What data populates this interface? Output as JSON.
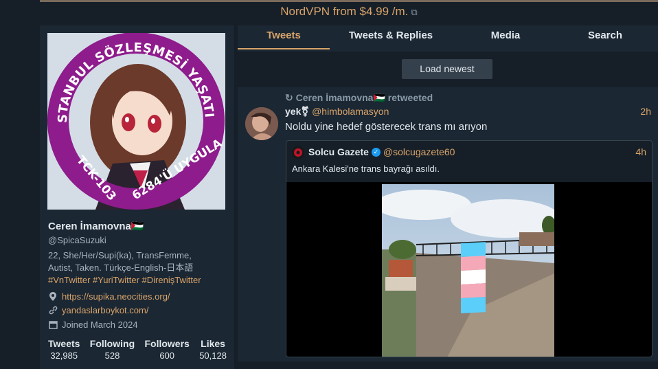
{
  "ad": {
    "text": "NordVPN from $4.99 /m.",
    "icon": "external-link-icon"
  },
  "profile": {
    "avatar_ring_top": "İSTANBUL SÖZLEŞMESİ YAŞATIR",
    "avatar_ring_left": "TCK-103",
    "avatar_ring_right": "6284'Ü UYGULA",
    "name": "Ceren İmamovna🇵🇸",
    "handle": "@SpicaSuzuki",
    "bio_line1": "22, She/Her/Supi(ka), TransFemme,",
    "bio_line2": "Autist, Taken. Türkçe-English-日本語",
    "bio_tags": "#VnTwitter #YuriTwitter #DirenişTwitter",
    "location_link": "https://supika.neocities.org/",
    "website": "yandaslarboykot.com/",
    "joined": "Joined March 2024",
    "stats": [
      {
        "label": "Tweets",
        "value": "32,985"
      },
      {
        "label": "Following",
        "value": "528"
      },
      {
        "label": "Followers",
        "value": "600"
      },
      {
        "label": "Likes",
        "value": "50,128"
      }
    ]
  },
  "tabs": [
    {
      "label": "Tweets"
    },
    {
      "label": "Tweets & Replies"
    },
    {
      "label": "Media"
    },
    {
      "label": "Search"
    }
  ],
  "load_newest": "Load newest",
  "tweet": {
    "retweet_text": "Ceren İmamovna🇵🇸 retweeted",
    "name": "yek⚧",
    "handle": "@himbolamasyon",
    "time": "2h",
    "text": "Noldu yine hedef gösterecek trans mı arıyon",
    "quote": {
      "name": "Solcu Gazete",
      "handle": "@solcugazete60",
      "time": "4h",
      "text": "Ankara Kalesi'ne trans bayrağı asıldı."
    }
  },
  "colors": {
    "accent": "#d9a46a",
    "bg": "#161f28",
    "panel": "#1b2733"
  }
}
